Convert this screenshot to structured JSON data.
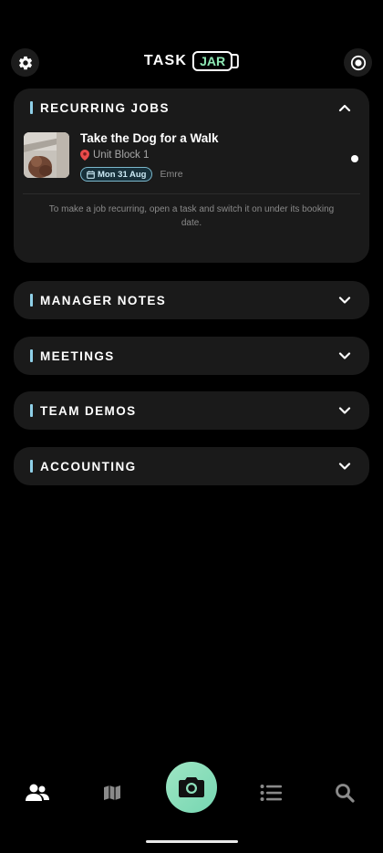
{
  "app": {
    "logo_word": "TASK",
    "logo_badge": "JAR"
  },
  "sections": [
    {
      "title": "RECURRING JOBS",
      "expanded": true
    },
    {
      "title": "MANAGER NOTES",
      "expanded": false
    },
    {
      "title": "MEETINGS",
      "expanded": false
    },
    {
      "title": "TEAM DEMOS",
      "expanded": false
    },
    {
      "title": "ACCOUNTING",
      "expanded": false
    }
  ],
  "recurring": {
    "job": {
      "title": "Take the Dog for a Walk",
      "location": "Unit Block 1",
      "date": "Mon 31 Aug",
      "assignee": "Emre"
    },
    "hint": "To make a job recurring, open a task and switch it on under its booking date."
  },
  "icons": {
    "settings": "gear-icon",
    "record": "record-icon",
    "location": "pin-icon",
    "calendar": "calendar-icon",
    "nav": [
      "people-icon",
      "map-icon",
      "camera-icon",
      "list-icon",
      "search-icon"
    ]
  },
  "colors": {
    "accent": "#8fd0e8",
    "brand_green": "#8ee8b4",
    "card_bg": "#1a1a1a",
    "background": "#000000"
  }
}
